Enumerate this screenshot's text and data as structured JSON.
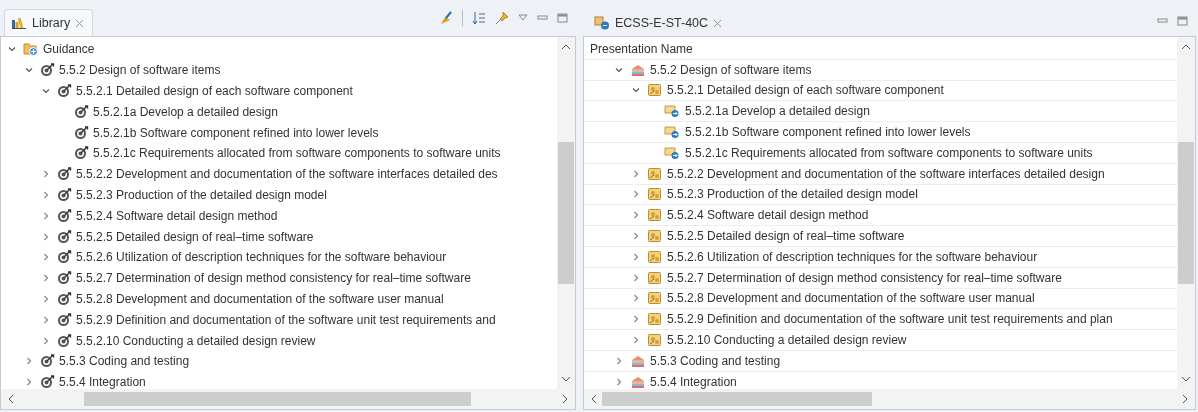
{
  "left_view": {
    "tab": {
      "title": "Library",
      "selected": true
    },
    "tree": [
      {
        "label": "Guidance",
        "kind": "folder",
        "expanded": true,
        "children": [
          {
            "label": "5.5.2 Design of software items",
            "kind": "target",
            "expanded": true,
            "children": [
              {
                "label": "5.5.2.1 Detailed design of each software component",
                "kind": "target",
                "expanded": true,
                "children": [
                  {
                    "label": "5.5.2.1a Develop a detailed design",
                    "kind": "target"
                  },
                  {
                    "label": "5.5.2.1b Software component refined into lower levels",
                    "kind": "target"
                  },
                  {
                    "label": "5.5.2.1c Requirements allocated from software components to software units",
                    "kind": "target"
                  }
                ]
              },
              {
                "label": "5.5.2.2 Development and documentation of the software interfaces detailed des",
                "kind": "target",
                "expanded": false
              },
              {
                "label": "5.5.2.3 Production of the detailed design model",
                "kind": "target",
                "expanded": false
              },
              {
                "label": "5.5.2.4 Software detail design method",
                "kind": "target",
                "expanded": false
              },
              {
                "label": "5.5.2.5 Detailed design of real–time software",
                "kind": "target",
                "expanded": false
              },
              {
                "label": "5.5.2.6 Utilization of description techniques for the software behaviour",
                "kind": "target",
                "expanded": false
              },
              {
                "label": "5.5.2.7 Determination of design method consistency for real–time software",
                "kind": "target",
                "expanded": false
              },
              {
                "label": "5.5.2.8 Development and documentation of the software user manual",
                "kind": "target",
                "expanded": false
              },
              {
                "label": "5.5.2.9 Definition and documentation of the software unit test requirements and",
                "kind": "target",
                "expanded": false
              },
              {
                "label": "5.5.2.10 Conducting a detailed design review",
                "kind": "target",
                "expanded": false
              }
            ]
          },
          {
            "label": "5.5.3 Coding and testing",
            "kind": "target",
            "expanded": false
          },
          {
            "label": "5.5.4 Integration",
            "kind": "target",
            "expanded": false
          }
        ]
      }
    ]
  },
  "right_view": {
    "tab": {
      "title": "ECSS-E-ST-40C",
      "selected": false
    },
    "column_header": "Presentation Name",
    "tree": [
      {
        "label": "5.5.2 Design of software items",
        "kind": "phase",
        "expanded": true,
        "children": [
          {
            "label": "5.5.2.1 Detailed design of each software component",
            "kind": "activity",
            "expanded": true,
            "children": [
              {
                "label": "5.5.2.1a Develop a detailed design",
                "kind": "task"
              },
              {
                "label": "5.5.2.1b Software component refined into lower levels",
                "kind": "task"
              },
              {
                "label": "5.5.2.1c Requirements allocated from software components to software units",
                "kind": "task"
              }
            ]
          },
          {
            "label": "5.5.2.2 Development and documentation of the software interfaces detailed design",
            "kind": "activity",
            "expanded": false
          },
          {
            "label": "5.5.2.3 Production of the detailed design model",
            "kind": "activity",
            "expanded": false
          },
          {
            "label": "5.5.2.4 Software detail design method",
            "kind": "activity",
            "expanded": false
          },
          {
            "label": "5.5.2.5 Detailed design of real–time software",
            "kind": "activity",
            "expanded": false
          },
          {
            "label": "5.5.2.6 Utilization of description techniques for the software behaviour",
            "kind": "activity",
            "expanded": false
          },
          {
            "label": "5.5.2.7 Determination of design method consistency for real–time software",
            "kind": "activity",
            "expanded": false
          },
          {
            "label": "5.5.2.8 Development and documentation of the software user manual",
            "kind": "activity",
            "expanded": false
          },
          {
            "label": "5.5.2.9 Definition and documentation of the software unit test requirements and plan",
            "kind": "activity",
            "expanded": false
          },
          {
            "label": "5.5.2.10 Conducting a detailed design review",
            "kind": "activity",
            "expanded": false
          }
        ]
      },
      {
        "label": "5.5.3 Coding and testing",
        "kind": "phase",
        "expanded": false
      },
      {
        "label": "5.5.4 Integration",
        "kind": "phase",
        "expanded": false
      }
    ]
  }
}
